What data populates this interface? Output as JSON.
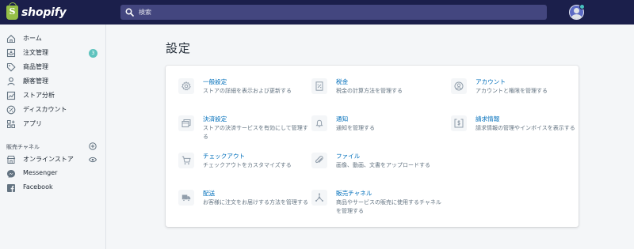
{
  "app": {
    "logo_text": "shopify",
    "logo_glyph": "S"
  },
  "search": {
    "placeholder": "検索",
    "icon": "search-icon"
  },
  "sidebar": {
    "items": [
      {
        "label": "ホーム",
        "icon": "home-icon"
      },
      {
        "label": "注文管理",
        "icon": "orders-icon",
        "badge": "3"
      },
      {
        "label": "商品管理",
        "icon": "tag-icon"
      },
      {
        "label": "顧客管理",
        "icon": "customer-icon"
      },
      {
        "label": "ストア分析",
        "icon": "analytics-icon"
      },
      {
        "label": "ディスカウント",
        "icon": "discount-icon"
      },
      {
        "label": "アプリ",
        "icon": "apps-icon"
      }
    ],
    "sales_channels_title": "販売チャネル",
    "channels": [
      {
        "label": "オンラインストア",
        "icon": "online-store-icon"
      },
      {
        "label": "Messenger",
        "icon": "messenger-icon"
      },
      {
        "label": "Facebook",
        "icon": "facebook-icon"
      }
    ]
  },
  "main": {
    "title": "設定",
    "settings": [
      {
        "title": "一般設定",
        "desc": "ストアの詳細を表示および更新する",
        "icon": "gear-icon"
      },
      {
        "title": "税金",
        "desc": "税金の計算方法を管理する",
        "icon": "tax-icon"
      },
      {
        "title": "アカウント",
        "desc": "アカウントと権限を管理する",
        "icon": "account-icon"
      },
      {
        "title": "決済設定",
        "desc": "ストアの決済サービスを有効にして管理する",
        "icon": "payment-icon"
      },
      {
        "title": "通知",
        "desc": "通知を管理する",
        "icon": "bell-icon"
      },
      {
        "title": "請求情報",
        "desc": "請求情報の管理やインボイスを表示する",
        "icon": "billing-icon"
      },
      {
        "title": "チェックアウト",
        "desc": "チェックアウトをカスタマイズする",
        "icon": "cart-icon"
      },
      {
        "title": "ファイル",
        "desc": "画像、動画、文書をアップロードする",
        "icon": "paperclip-icon"
      },
      {
        "title": "配送",
        "desc": "お客様に注文をお届けする方法を管理する",
        "icon": "truck-icon"
      },
      {
        "title": "販売チャネル",
        "desc": "商品やサービスの販売に使用するチャネルを管理する",
        "icon": "channels-icon"
      }
    ]
  },
  "colors": {
    "topbar": "#1b1f4b",
    "search_bg": "#43467f",
    "link": "#006fbb",
    "badge": "#5ec3be",
    "logo_green": "#95bf47"
  }
}
